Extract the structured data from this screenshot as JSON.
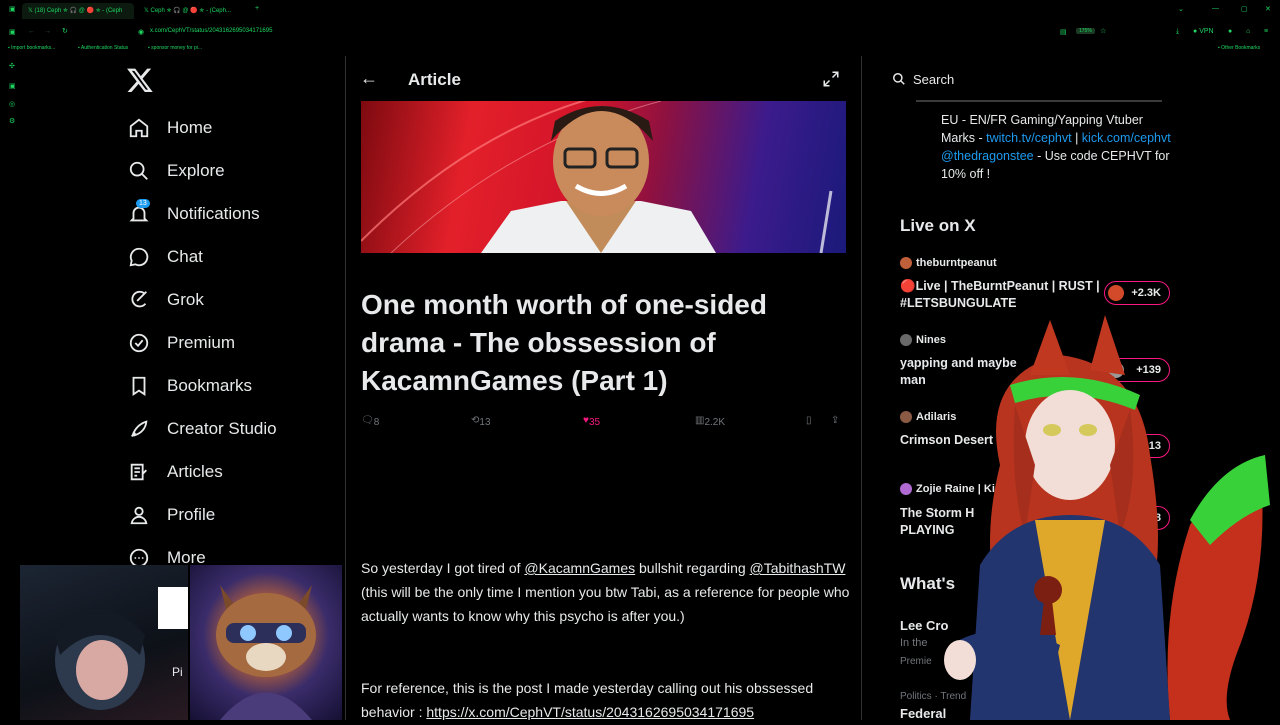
{
  "browser": {
    "tabs": [
      {
        "title": "(18) Ceph ✯ 🎧 @ 🔴 ✯ - (Ceph"
      },
      {
        "title": "Ceph ✯ 🎧 @ 🔴 ✯ - (Ceph..."
      }
    ],
    "url": "x.com/CephVT/status/2043162695034171695",
    "zoom": "175%",
    "vpn_label": "VPN",
    "bookmarks": [
      "Import bookmarks...",
      "Authentication Status",
      "sponsor money for pi...",
      "Other Bookmarks"
    ]
  },
  "nav": {
    "items": [
      {
        "label": "Home",
        "icon": "home-icon"
      },
      {
        "label": "Explore",
        "icon": "search-icon"
      },
      {
        "label": "Notifications",
        "icon": "bell-icon",
        "badge": "13"
      },
      {
        "label": "Chat",
        "icon": "chat-icon"
      },
      {
        "label": "Grok",
        "icon": "grok-icon"
      },
      {
        "label": "Premium",
        "icon": "premium-icon"
      },
      {
        "label": "Bookmarks",
        "icon": "bookmark-icon"
      },
      {
        "label": "Creator Studio",
        "icon": "rocket-icon"
      },
      {
        "label": "Articles",
        "icon": "articles-icon"
      },
      {
        "label": "Profile",
        "icon": "profile-icon"
      },
      {
        "label": "More",
        "icon": "more-icon"
      }
    ]
  },
  "cam_label": "Pi",
  "article": {
    "header": "Article",
    "title": "One month worth of one-sided drama - The obssession of KacamnGames (Part 1)",
    "stats": {
      "replies": "8",
      "reposts": "13",
      "likes": "35",
      "views": "2.2K"
    },
    "p1_a": "So yesterday I got tired of ",
    "p1_mention1": "@KacamnGames",
    "p1_b": "  bullshit regarding ",
    "p1_mention2": "@TabithashTW",
    "p1_c": " (this will be the only time I mention you btw Tabi, as a reference for people who actually wants to know why this psycho is after you.)",
    "p2_a": "For reference, this is the post I made yesterday calling out his obssessed behavior : ",
    "p2_link": "https://x.com/CephVT/status/2043162695034171695"
  },
  "sidebar": {
    "search_placeholder": "Search",
    "bio_a": "EU - EN/FR Gaming/Yapping Vtuber Marks - ",
    "bio_link1": "twitch.tv/cephvt",
    "bio_sep": " | ",
    "bio_link2": "kick.com/cephvt",
    "bio_link3": "@thedragonstee",
    "bio_b": " - Use code CEPHVT for 10% off !",
    "live_heading": "Live on X",
    "live": [
      {
        "user": "theburntpeanut",
        "title": "🔴Live | TheBurntPeanut | RUST | #LETSBUNGULATE",
        "count": "+2.3K"
      },
      {
        "user": "Nines",
        "title": "yapping and maybe man",
        "count": "+139"
      },
      {
        "user": "Adilaris",
        "title": "Crimson Desert",
        "count": "+13"
      },
      {
        "user": "Zojie Raine | Ki",
        "title": "The Storm H PLAYING",
        "count": "8"
      }
    ],
    "whats_heading": "What's",
    "trends": [
      {
        "name": "Lee Cro",
        "meta": "In the",
        "meta2": "Premie"
      },
      {
        "name": "Federal",
        "meta": "Politics · Trend"
      }
    ]
  },
  "colors": {
    "accent_green": "#1ed760",
    "x_blue": "#1d9bf0",
    "live_pink": "#f91880"
  }
}
